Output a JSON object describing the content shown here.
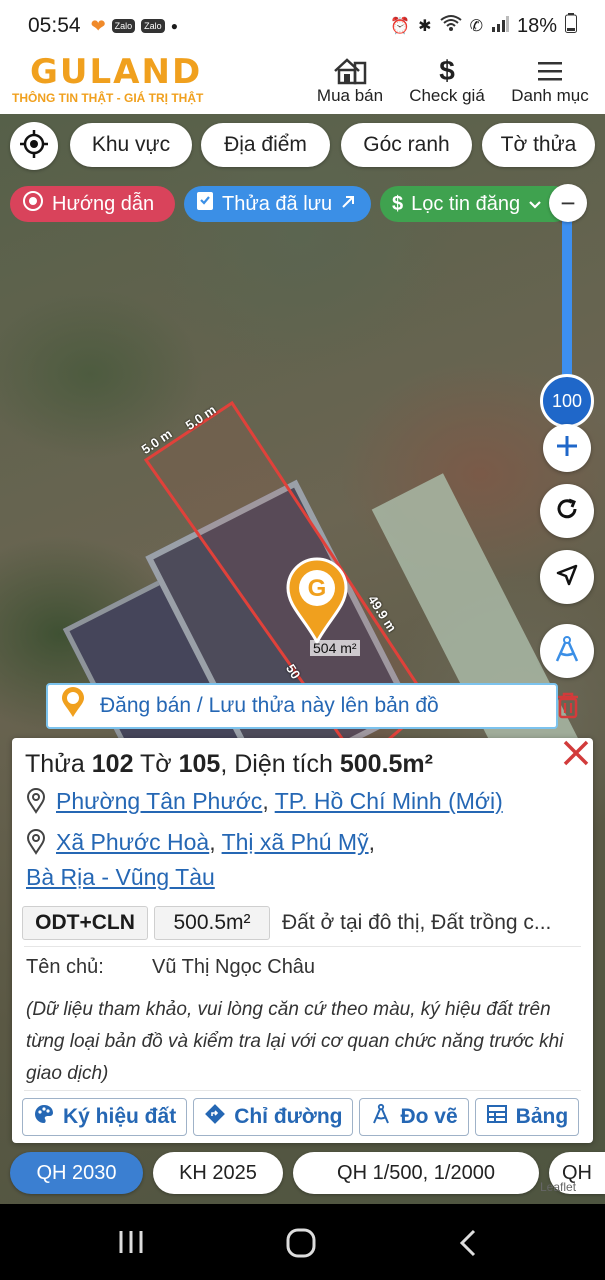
{
  "status_bar": {
    "time": "05:54",
    "battery": "18%",
    "notification_icons": [
      "heart-icon",
      "zalo-icon",
      "zalo-icon",
      "dot-icon"
    ],
    "status_icons": [
      "alarm-icon",
      "bluetooth-icon",
      "wifi-icon",
      "call-icon",
      "signal-icon",
      "battery-icon"
    ],
    "zalo_label": "Zalo"
  },
  "header": {
    "brand": "GULAND",
    "slogan": "THÔNG TIN THẬT - GIÁ TRỊ THẬT",
    "nav": [
      {
        "label": "Mua bán",
        "icon": "house-icon"
      },
      {
        "label": "Check giá",
        "icon": "dollar-icon"
      },
      {
        "label": "Danh mục",
        "icon": "menu-icon"
      }
    ]
  },
  "filters": {
    "chips": [
      "Khu vực",
      "Địa điểm",
      "Góc ranh",
      "Tờ thửa"
    ],
    "guide": "Hướng dẫn",
    "saved": "Thửa đã lưu",
    "listing_filter": "Lọc tin đăng"
  },
  "map": {
    "zoom_level": "100",
    "plot_area_label": "504 m²",
    "dimensions": [
      "5.0 m",
      "5.0 m",
      "49.9 m",
      "50"
    ],
    "attribution": "Leaflet"
  },
  "post_banner": "Đăng bán / Lưu thửa này lên bản đồ",
  "parcel": {
    "label_parcel": "Thửa",
    "parcel_no": "102",
    "label_sheet": "Tờ",
    "sheet_no": "105",
    "label_area": ", Diện tích",
    "area": "500.5m²",
    "address_new": {
      "ward": "Phường Tân Phước",
      "city": "TP. Hồ Chí Minh (Mới)"
    },
    "address_old": {
      "commune": "Xã Phước Hoà",
      "town": "Thị xã Phú Mỹ",
      "province": "Bà Rịa - Vũng Tàu"
    },
    "comma": ",",
    "land_code": "ODT+CLN",
    "land_area": "500.5m²",
    "land_desc": "Đất ở tại đô thị, Đất trồng c...",
    "owner_label": "Tên chủ:",
    "owner_name": "Vũ Thị Ngọc Châu",
    "disclaimer": "(Dữ liệu tham khảo, vui lòng căn cứ theo màu, ký hiệu đất trên từng loại bản đồ và kiểm tra lại với cơ quan chức năng trước khi giao dịch)",
    "actions": [
      "Ký hiệu đất",
      "Chỉ đường",
      "Đo vẽ",
      "Bảng"
    ]
  },
  "plans": [
    "QH 2030",
    "KH 2025",
    "QH 1/500, 1/2000",
    "QH"
  ],
  "colors": {
    "brand": "#f0a01e",
    "link": "#2567b4",
    "guide_pill": "#d9435b",
    "saved_pill": "#3b8fe6",
    "filter_pill": "#3fa24f",
    "active_plan": "#3b7fd1",
    "parcel_border": "#e0413a"
  }
}
